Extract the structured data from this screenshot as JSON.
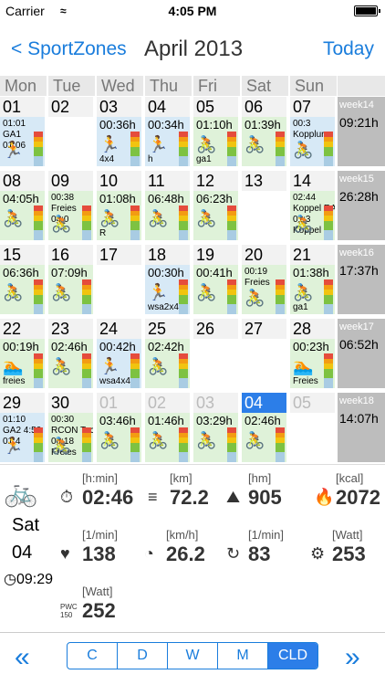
{
  "status": {
    "carrier": "Carrier",
    "time": "4:05 PM"
  },
  "nav": {
    "back": "< SportZones",
    "title": "April 2013",
    "today": "Today"
  },
  "weekdays": [
    "Mon",
    "Tue",
    "Wed",
    "Thu",
    "Fri",
    "Sat",
    "Sun"
  ],
  "colors": {
    "accent": "#2c7ee8",
    "link": "#1a7ddc",
    "bar_red": "#e54c3c",
    "bar_orange": "#f39c12",
    "bar_yellow": "#f1c40f",
    "bar_green": "#7dc242",
    "bar_blue": "#a9cce3"
  },
  "cells": [
    {
      "day": "01",
      "bg": "blue",
      "small": [
        "01:01",
        "GA1",
        "01:06"
      ],
      "icon": "run-icon"
    },
    {
      "day": "02",
      "bg": "white"
    },
    {
      "day": "03",
      "bg": "blue",
      "dur": "00:36h",
      "icon": "run-icon",
      "lbl": "4x4"
    },
    {
      "day": "04",
      "bg": "blue",
      "dur": "00:34h",
      "icon": "run-icon",
      "lbl": "h"
    },
    {
      "day": "05",
      "bg": "green",
      "dur": "01:10h",
      "icon": "bike-icon",
      "lbl": "ga1"
    },
    {
      "day": "06",
      "bg": "green",
      "dur": "01:39h",
      "icon": "bike-icon"
    },
    {
      "day": "07",
      "bg": "blue",
      "small": [
        "00:3",
        "Kopplur"
      ],
      "icon": "bike-icon"
    },
    {
      "day": "08",
      "bg": "green",
      "dur": "04:05h",
      "icon": "bike-icon"
    },
    {
      "day": "09",
      "bg": "green",
      "small": [
        "00:38",
        "Freies",
        "04:0"
      ],
      "icon": "bike-icon"
    },
    {
      "day": "10",
      "bg": "green",
      "dur": "01:08h",
      "icon": "bike-icon",
      "lbl": "R"
    },
    {
      "day": "11",
      "bg": "green",
      "dur": "06:48h",
      "icon": "bike-icon"
    },
    {
      "day": "12",
      "bg": "green",
      "dur": "06:23h",
      "icon": "bike-icon"
    },
    {
      "day": "13",
      "bg": "white"
    },
    {
      "day": "14",
      "bg": "green",
      "small": [
        "02:44",
        "Koppel RA",
        "01:3",
        "Koppel"
      ],
      "icon": "bike-icon"
    },
    {
      "day": "15",
      "bg": "green",
      "dur": "06:36h",
      "icon": "bike-icon"
    },
    {
      "day": "16",
      "bg": "green",
      "dur": "07:09h",
      "icon": "bike-icon"
    },
    {
      "day": "17",
      "bg": "white"
    },
    {
      "day": "18",
      "bg": "blue",
      "dur": "00:30h",
      "icon": "run-icon",
      "lbl": "wsa2x4"
    },
    {
      "day": "19",
      "bg": "green",
      "dur": "00:41h",
      "icon": "bike-icon"
    },
    {
      "day": "20",
      "bg": "green",
      "small": [
        "00:19",
        "Freies"
      ],
      "icon": "bike-icon"
    },
    {
      "day": "21",
      "bg": "green",
      "dur": "01:38h",
      "icon": "bike-icon",
      "lbl": "ga1"
    },
    {
      "day": "22",
      "bg": "green",
      "dur": "00:19h",
      "icon": "swim-icon",
      "lbl": "freies"
    },
    {
      "day": "23",
      "bg": "green",
      "dur": "02:46h",
      "icon": "bike-icon"
    },
    {
      "day": "24",
      "bg": "blue",
      "dur": "00:42h",
      "icon": "run-icon",
      "lbl": "wsa4x4"
    },
    {
      "day": "25",
      "bg": "green",
      "dur": "02:42h",
      "icon": "bike-icon"
    },
    {
      "day": "26",
      "bg": "white"
    },
    {
      "day": "27",
      "bg": "white"
    },
    {
      "day": "28",
      "bg": "green",
      "dur": "00:23h",
      "icon": "swim-icon",
      "lbl": "Freies"
    },
    {
      "day": "29",
      "bg": "blue",
      "small": [
        "01:10",
        "GA2 4:50",
        "01:4"
      ],
      "icon": "run-icon"
    },
    {
      "day": "30",
      "bg": "green",
      "small": [
        "00:30",
        "RCON Tac",
        "00:18",
        "Freies"
      ],
      "icon": "bike-icon"
    },
    {
      "day": "01",
      "bg": "green",
      "dur": "03:46h",
      "icon": "bike-icon",
      "other": true
    },
    {
      "day": "02",
      "bg": "green",
      "dur": "01:46h",
      "icon": "bike-icon",
      "other": true
    },
    {
      "day": "03",
      "bg": "green",
      "dur": "03:29h",
      "icon": "bike-icon",
      "other": true
    },
    {
      "day": "04",
      "bg": "green",
      "dur": "02:46h",
      "icon": "bike-icon",
      "other": true,
      "sel": true
    },
    {
      "day": "05",
      "bg": "white",
      "other": true
    }
  ],
  "weeks": [
    {
      "label": "week14",
      "total": "09:21h"
    },
    {
      "label": "week15",
      "total": "26:28h"
    },
    {
      "label": "week16",
      "total": "17:37h"
    },
    {
      "label": "week17",
      "total": "06:52h"
    },
    {
      "label": "week18",
      "total": "14:07h"
    }
  ],
  "detail": {
    "dow": "Sat",
    "day": "04",
    "time": "09:29",
    "stats": [
      {
        "unit": "[h:min]",
        "value": "02:46",
        "icon": "stopwatch-icon"
      },
      {
        "unit": "[km]",
        "value": "72.2",
        "icon": "road-icon"
      },
      {
        "unit": "[hm]",
        "value": "905",
        "icon": "mountain-icon"
      },
      {
        "unit": "[kcal]",
        "value": "2072",
        "icon": "flame-icon"
      },
      {
        "unit": "[1/min]",
        "value": "138",
        "icon": "heart-icon"
      },
      {
        "unit": "[km/h]",
        "value": "26.2",
        "icon": "speedometer-icon"
      },
      {
        "unit": "[1/min]",
        "value": "83",
        "icon": "cadence-icon"
      },
      {
        "unit": "[Watt]",
        "value": "253",
        "icon": "power-icon"
      },
      {
        "unit": "[Watt]",
        "value": "252",
        "icon": "pwc-icon",
        "label": "PWC 150"
      }
    ]
  },
  "segments": [
    "C",
    "D",
    "W",
    "M",
    "CLD"
  ],
  "active_segment": "CLD"
}
